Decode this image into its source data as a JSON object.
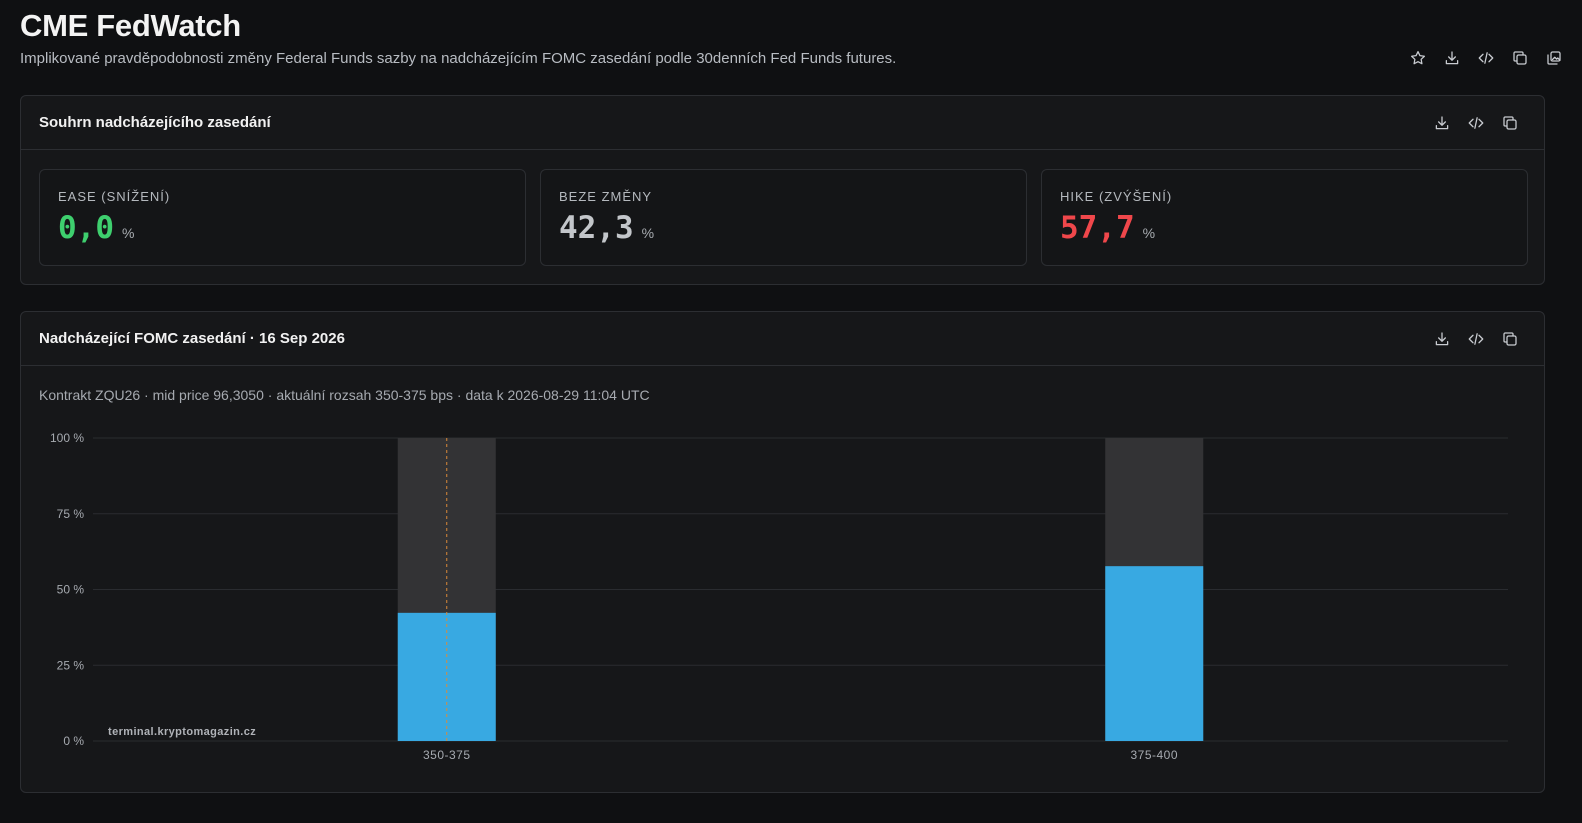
{
  "page": {
    "title": "CME FedWatch",
    "subtitle": "Implikované pravděpodobnosti změny Federal Funds sazby na nadcházejícím FOMC zasedání podle 30denních Fed Funds futures.",
    "toolbar_icons": [
      "star-icon",
      "download-icon",
      "code-icon",
      "copy-icon",
      "copy-image-icon"
    ]
  },
  "summary": {
    "title": "Souhrn nadcházejícího zasedání",
    "toolbar_icons": [
      "download-icon",
      "code-icon",
      "copy-icon"
    ],
    "stats": [
      {
        "label": "EASE (SNÍŽENÍ)",
        "value": "0,0",
        "unit": "%",
        "color": "#3ecf6e"
      },
      {
        "label": "BEZE ZMĚNY",
        "value": "42,3",
        "unit": "%",
        "color": "#c3c6ca"
      },
      {
        "label": "HIKE (ZVÝŠENÍ)",
        "value": "57,7",
        "unit": "%",
        "color": "#f0474b"
      }
    ]
  },
  "fomc": {
    "title": "Nadcházející FOMC zasedání · 16 Sep 2026",
    "toolbar_icons": [
      "download-icon",
      "code-icon",
      "copy-icon"
    ],
    "caption": "Kontrakt ZQU26 · mid price 96,3050 · aktuální rozsah 350-375 bps · data k 2026-08-29 11:04 UTC",
    "watermark": "terminal.kryptomagazin.cz"
  },
  "chart_data": {
    "type": "bar",
    "categories": [
      "350-375",
      "375-400"
    ],
    "values": [
      42.3,
      57.7
    ],
    "ylim": [
      0,
      100
    ],
    "yticks": [
      0,
      25,
      50,
      75,
      100
    ],
    "ytick_labels": [
      "0 %",
      "25 %",
      "50 %",
      "75 %",
      "100 %"
    ],
    "current_range": "350-375",
    "grid": true,
    "colors": {
      "bar": "#38a9e2",
      "track": "#333335",
      "marker": "#d98a3a",
      "grid": "#2a2c30"
    }
  }
}
